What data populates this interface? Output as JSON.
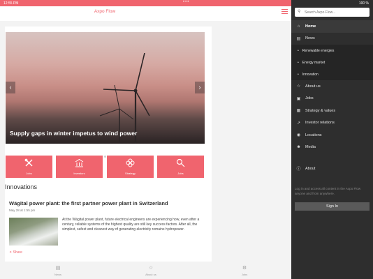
{
  "status": {
    "time": "12:55 PM",
    "battery": "100 %"
  },
  "app": {
    "title": "Axpo Flow"
  },
  "hero": {
    "caption": "Supply gaps in winter impetus to wind power",
    "slide_count": 3,
    "active_slide": 1
  },
  "tiles": [
    {
      "label": "Jobs",
      "icon": "tools-icon"
    },
    {
      "label": "Investors",
      "icon": "building-icon"
    },
    {
      "label": "Strategy",
      "icon": "flower-icon"
    },
    {
      "label": "Jobs",
      "icon": "magnifier-icon"
    }
  ],
  "innovations": {
    "section_title": "Innovations",
    "article_title": "Wägital power plant: the first partner power plant in Switzerland",
    "date": "May 28 at 1:55 pm",
    "body": "At the Wägital power plant, future electrical engineers are experiencing how, even after a century, reliable systems of the highest quality are still key success factors. After all, the simplest, safest and cleanest way of generating electricity remains hydropower.",
    "share": "Share"
  },
  "bottom_tabs": [
    {
      "label": "News",
      "icon": "news-icon"
    },
    {
      "label": "About us",
      "icon": "star-icon"
    },
    {
      "label": "Jobs",
      "icon": "people-icon"
    }
  ],
  "drawer": {
    "search_placeholder": "Search Axpo Flow...",
    "items": [
      {
        "label": "Home",
        "icon": "home-icon"
      },
      {
        "label": "News",
        "icon": "news-icon"
      },
      {
        "label": "About us",
        "icon": "star-icon"
      },
      {
        "label": "Jobs",
        "icon": "briefcase-icon"
      },
      {
        "label": "Strategy & values",
        "icon": "grid-icon"
      },
      {
        "label": "Investor relations",
        "icon": "chart-icon"
      },
      {
        "label": "Locations",
        "icon": "pin-icon"
      },
      {
        "label": "Media",
        "icon": "people-icon"
      },
      {
        "label": "About",
        "icon": "info-icon"
      }
    ],
    "sub_items": [
      "Renewable energies",
      "Energy market",
      "Innovation"
    ],
    "login_text": "Log in and access all content in the Axpo Flow anyone and from anywhere.",
    "signin": "Sign In"
  },
  "colors": {
    "accent": "#f0646e",
    "drawer_bg": "#2e2e2e"
  }
}
